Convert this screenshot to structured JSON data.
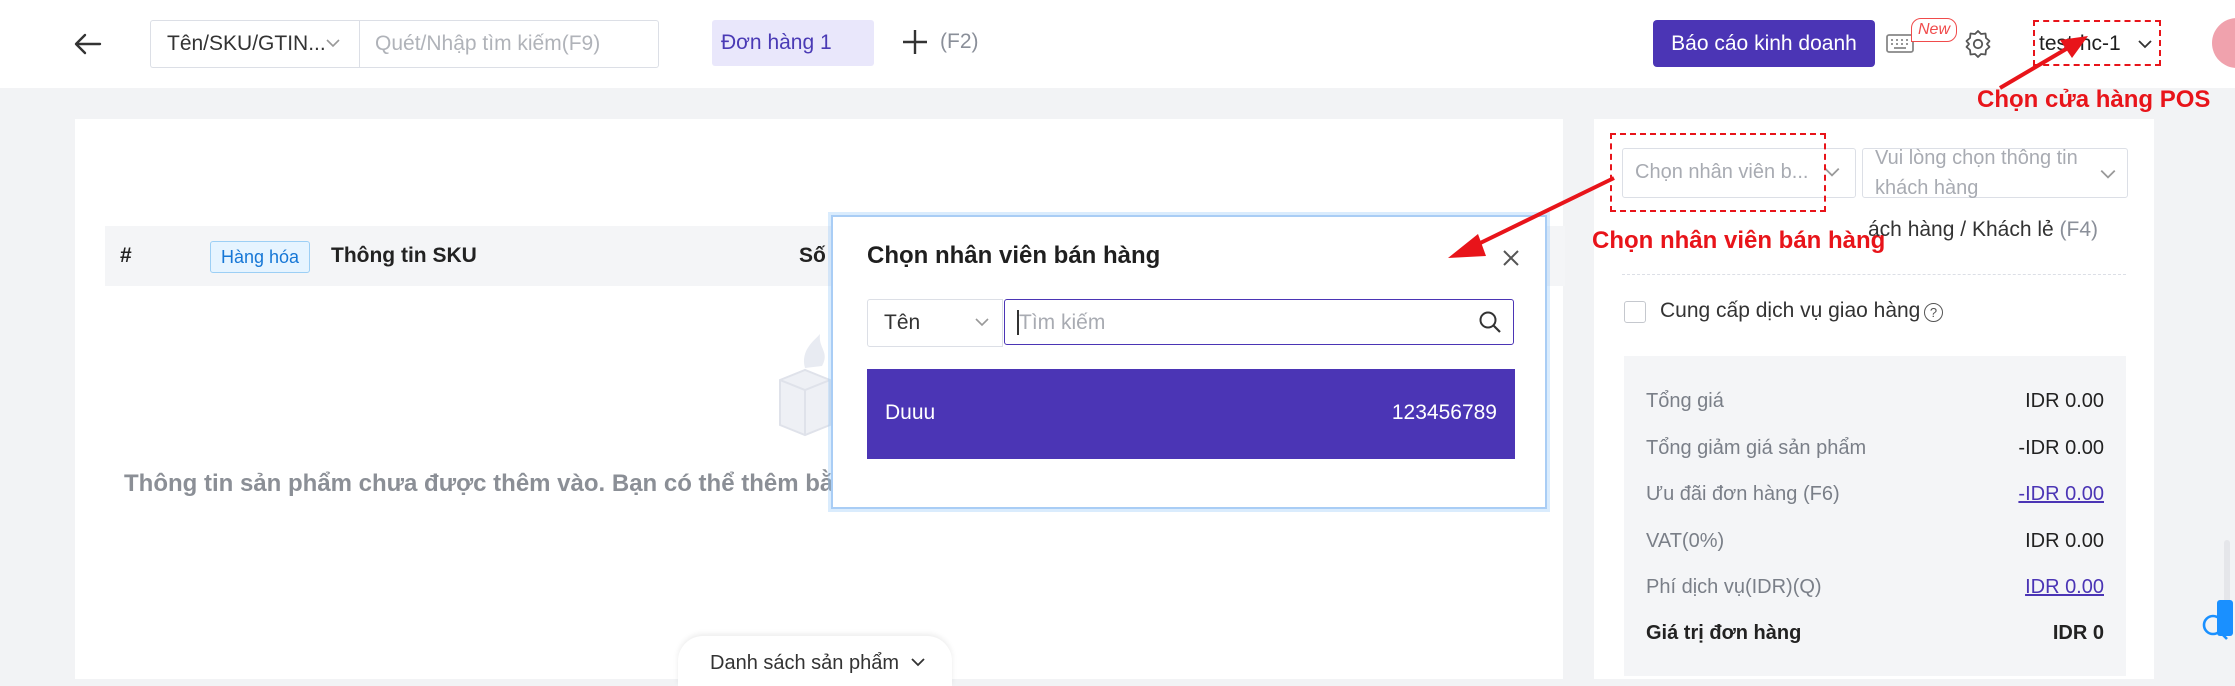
{
  "topbar": {
    "search_type": "Tên/SKU/GTIN...",
    "search_placeholder": "Quét/Nhập tìm kiếm(F9)",
    "order_tab": "Đơn hàng 1",
    "add_order_shortcut": "(F2)",
    "report_button": "Báo cáo kinh doanh",
    "new_badge": "New",
    "store_name": "test-hc-1"
  },
  "annotations": {
    "store_callout": "Chọn cửa hàng POS",
    "staff_callout": "Chọn nhân viên bán hàng",
    "accent_color": "#e8141a"
  },
  "table": {
    "col_index": "#",
    "goods_tag": "Hàng hóa",
    "col_sku": "Thông tin SKU",
    "col_qty_partial": "Số",
    "empty_text": "Thông tin sản phẩm chưa được thêm vào. Bạn có thể thêm bằng c",
    "bottom_tab": "Danh sách sản phẩm"
  },
  "right_panel": {
    "staff_placeholder": "Chọn nhân viên b...",
    "customer_placeholder": "Vui lòng chọn thông tin khách hàng",
    "customer_type_prefix": "ách hàng",
    "customer_type_sep": "/",
    "customer_type_value": "Khách lẻ",
    "customer_type_shortcut": "(F4)",
    "delivery_label": "Cung cấp dịch vụ giao hàng",
    "summary": [
      {
        "label": "Tổng giá",
        "value": "IDR 0.00",
        "link": false
      },
      {
        "label": "Tổng giảm giá sản phẩm",
        "value": "-IDR 0.00",
        "link": false
      },
      {
        "label": "Ưu đãi đơn hàng (F6)",
        "value": "-IDR 0.00",
        "link": true
      },
      {
        "label": "VAT(0%)",
        "value": "IDR 0.00",
        "link": false
      },
      {
        "label": "Phí dịch vụ(IDR)(Q)",
        "value": "IDR 0.00",
        "link": true
      },
      {
        "label": "Giá trị đơn hàng",
        "value": "IDR 0",
        "link": false
      }
    ]
  },
  "modal": {
    "title": "Chọn nhân viên bán hàng",
    "field": "Tên",
    "search_placeholder": "Tìm kiếm",
    "employee_name": "Duuu",
    "employee_phone": "123456789",
    "primary_color": "#4b35b5"
  }
}
